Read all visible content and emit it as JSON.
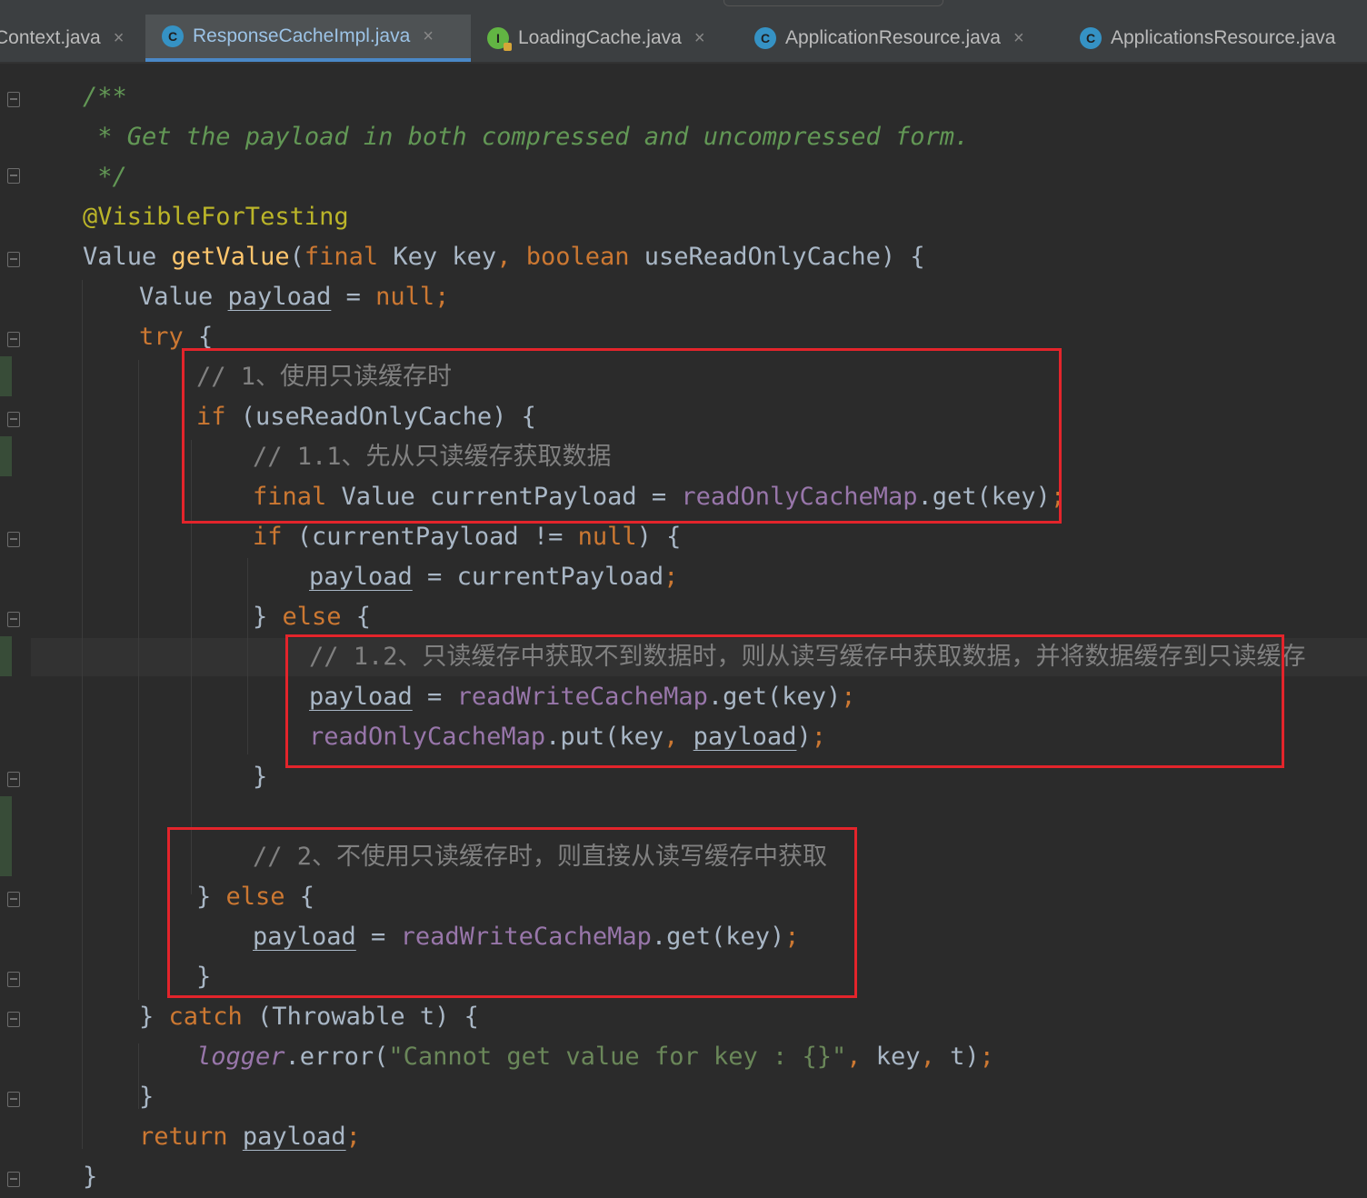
{
  "tabs": [
    {
      "label": "Context.java",
      "icon": "class-icon",
      "active": false
    },
    {
      "label": "ResponseCacheImpl.java",
      "icon": "class-icon",
      "active": true
    },
    {
      "label": "LoadingCache.java",
      "icon": "interface-icon",
      "active": false
    },
    {
      "label": "ApplicationResource.java",
      "icon": "class-icon",
      "active": false
    },
    {
      "label": "ApplicationsResource.java",
      "icon": "class-icon",
      "active": false
    }
  ],
  "tab_close_glyph": "×",
  "icon_letters": {
    "class": "C",
    "interface": "I"
  },
  "code": {
    "doc_open": "/**",
    "doc_text": " * Get the payload in both compressed and uncompressed form.",
    "doc_close": " */",
    "annotation": "@VisibleForTesting",
    "sig": {
      "ret": "Value ",
      "name": "getValue",
      "p1": "(",
      "kw_final": "final",
      "p2": " Key key",
      "comma": ", ",
      "kw_boolean": "boolean",
      "p3": " useReadOnlyCache) {"
    },
    "decl": {
      "t": "Value ",
      "v": "payload",
      "eq": " = ",
      "nul": "null",
      "semi": ";"
    },
    "try": {
      "kw": "try",
      "rest": " {"
    },
    "comment1": "// 1、使用只读缓存时",
    "if1": {
      "kw": "if",
      "rest": " (useReadOnlyCache) {"
    },
    "comment11": "// 1.1、先从只读缓存获取数据",
    "final_line": {
      "kw": "final",
      "rest": " Value currentPayload = ",
      "field": "readOnlyCacheMap",
      "call": ".get(key)",
      "semi": ";"
    },
    "if2": {
      "kw": "if",
      "a": " (currentPayload != ",
      "nul": "null",
      "b": ") {"
    },
    "assign1": {
      "v": "payload",
      "rest": " = currentPayload",
      "semi": ";"
    },
    "else1": {
      "a": "} ",
      "kw": "else",
      "b": " {"
    },
    "comment12": "// 1.2、只读缓存中获取不到数据时，则从读写缓存中获取数据，并将数据缓存到只读缓存",
    "assign2": {
      "v": "payload",
      "eq": " = ",
      "field": "readWriteCacheMap",
      "call": ".get(key)",
      "semi": ";"
    },
    "put": {
      "field": "readOnlyCacheMap",
      "a": ".put(key",
      "comma": ", ",
      "v": "payload",
      "b": ")",
      "semi": ";"
    },
    "close_brace": "}",
    "comment2": "// 2、不使用只读缓存时，则直接从读写缓存中获取",
    "else2": {
      "a": "} ",
      "kw": "else",
      "b": " {"
    },
    "assign3": {
      "v": "payload",
      "eq": " = ",
      "field": "readWriteCacheMap",
      "call": ".get(key)",
      "semi": ";"
    },
    "catch": {
      "a": "} ",
      "kw": "catch",
      "b": " (Throwable t) {"
    },
    "log": {
      "obj": "logger",
      "call": ".error(",
      "str": "\"Cannot get value for key : {}\"",
      "comma": ", ",
      "key": "key",
      "comma2": ", ",
      "t": "t)",
      "semi": ";"
    },
    "ret": {
      "kw": "return",
      "sp": " ",
      "v": "payload",
      "semi": ";"
    }
  },
  "colors": {
    "background": "#2b2b2b",
    "keyword": "#cc7832",
    "doc_comment": "#629755",
    "annotation": "#bbb529",
    "method": "#ffc66d",
    "field": "#9876aa",
    "string": "#6a8759",
    "line_comment": "#808080",
    "highlight_box": "#e3242b",
    "tab_accent": "#4a88c7"
  }
}
